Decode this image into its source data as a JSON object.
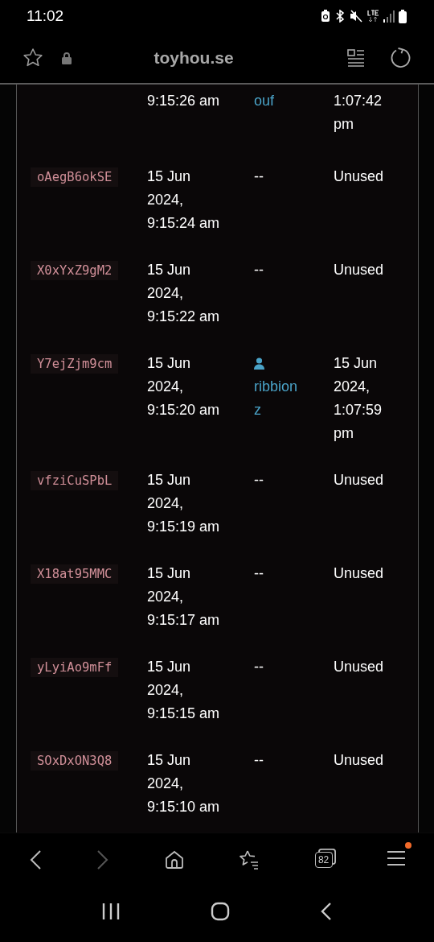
{
  "status_bar": {
    "time": "11:02"
  },
  "address_bar": {
    "url": "toyhou.se"
  },
  "table": {
    "rows": [
      {
        "created": "9:15:26 am",
        "user": "ouf",
        "user_icon": false,
        "used": "1:07:42 pm"
      },
      {
        "code": "oAegB6okSE",
        "created": "15 Jun 2024, 9:15:24 am",
        "user_placeholder": "--",
        "used": "Unused"
      },
      {
        "code": "X0xYxZ9gM2",
        "created": "15 Jun 2024, 9:15:22 am",
        "user_placeholder": "--",
        "used": "Unused"
      },
      {
        "code": "Y7ejZjm9cm",
        "created": "15 Jun 2024, 9:15:20 am",
        "user": "ribbionz",
        "user_icon": true,
        "used": "15 Jun 2024, 1:07:59 pm"
      },
      {
        "code": "vfziCuSPbL",
        "created": "15 Jun 2024, 9:15:19 am",
        "user_placeholder": "--",
        "used": "Unused"
      },
      {
        "code": "X18at95MMC",
        "created": "15 Jun 2024, 9:15:17 am",
        "user_placeholder": "--",
        "used": "Unused"
      },
      {
        "code": "yLyiAo9mFf",
        "created": "15 Jun 2024, 9:15:15 am",
        "user_placeholder": "--",
        "used": "Unused"
      },
      {
        "code": "SOxDxON3Q8",
        "created": "15 Jun 2024, 9:15:10 am",
        "user_placeholder": "--",
        "used": "Unused"
      }
    ]
  },
  "browser_toolbar": {
    "forward_disabled": true,
    "tab_count": "82",
    "menu_notification": true
  }
}
